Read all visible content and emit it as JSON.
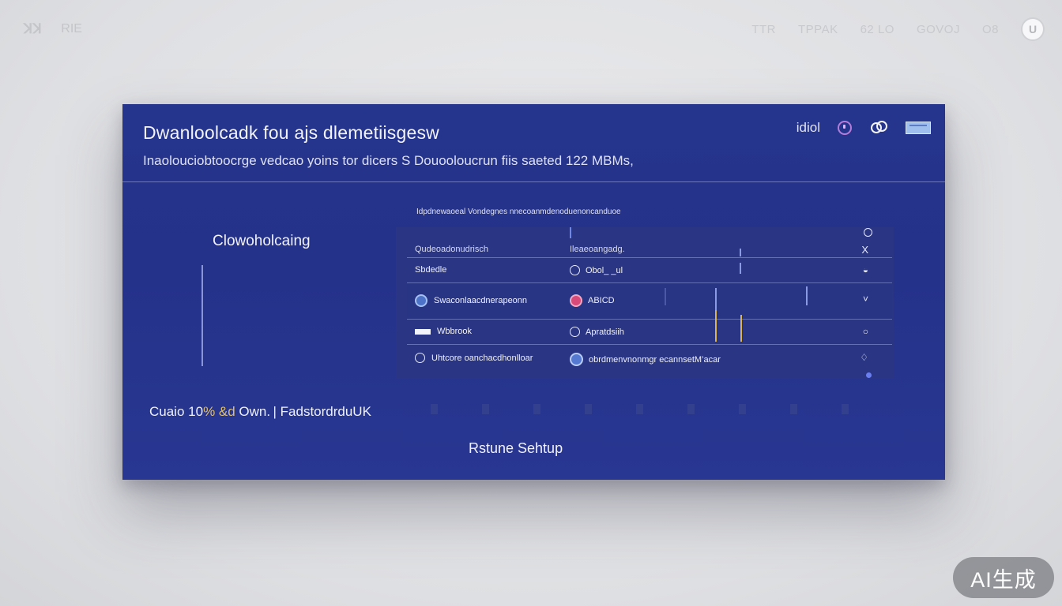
{
  "topbar": {
    "logo": "ꓘꓘ",
    "left_text": "RIE",
    "items": [
      "TTR",
      "TPPAK",
      "62 LO",
      "GOVOJ",
      "O8"
    ],
    "avatar_letter": "U"
  },
  "dialog": {
    "title": "Dwanloolcadk fou ajs dlemetiisgesw",
    "subtitle": "Inaolouciobtoocrge vedcao yoins  tor dicers S Douooloucrun  fiis  saeted 122 MBMs,",
    "header_label": "idiol",
    "side_title": "Clowoholcaing",
    "list": {
      "caption": "Idpdnewaoeal  Vondegnes  nnecoanmdenoduenoncanduoe",
      "header": {
        "col1": "Qudeoadonudrisch",
        "col2": "Ileaeoangadg.",
        "close": "X"
      },
      "rows": [
        {
          "col1": "Sbdedle",
          "col2": "Obol_ _ul",
          "action": "◒"
        },
        {
          "col1": "Swaconlaacdnerapeonn",
          "col2": "ABICD",
          "action": "˅"
        },
        {
          "col1": "Wbbrook",
          "col2": "Apratdsiih",
          "action": "○"
        },
        {
          "col1": "Uhtcore oanchacdhonlloar",
          "col2": "obrdmenvnonmgr ecannsetM’acar",
          "action": "♢"
        }
      ]
    },
    "status": {
      "prefix": "Cuaio 10",
      "accent": "% &d",
      "suffix": " Own. | FadstordrduUK"
    },
    "restore_label": "Rstune Sehtup"
  },
  "badge": "AI生成"
}
